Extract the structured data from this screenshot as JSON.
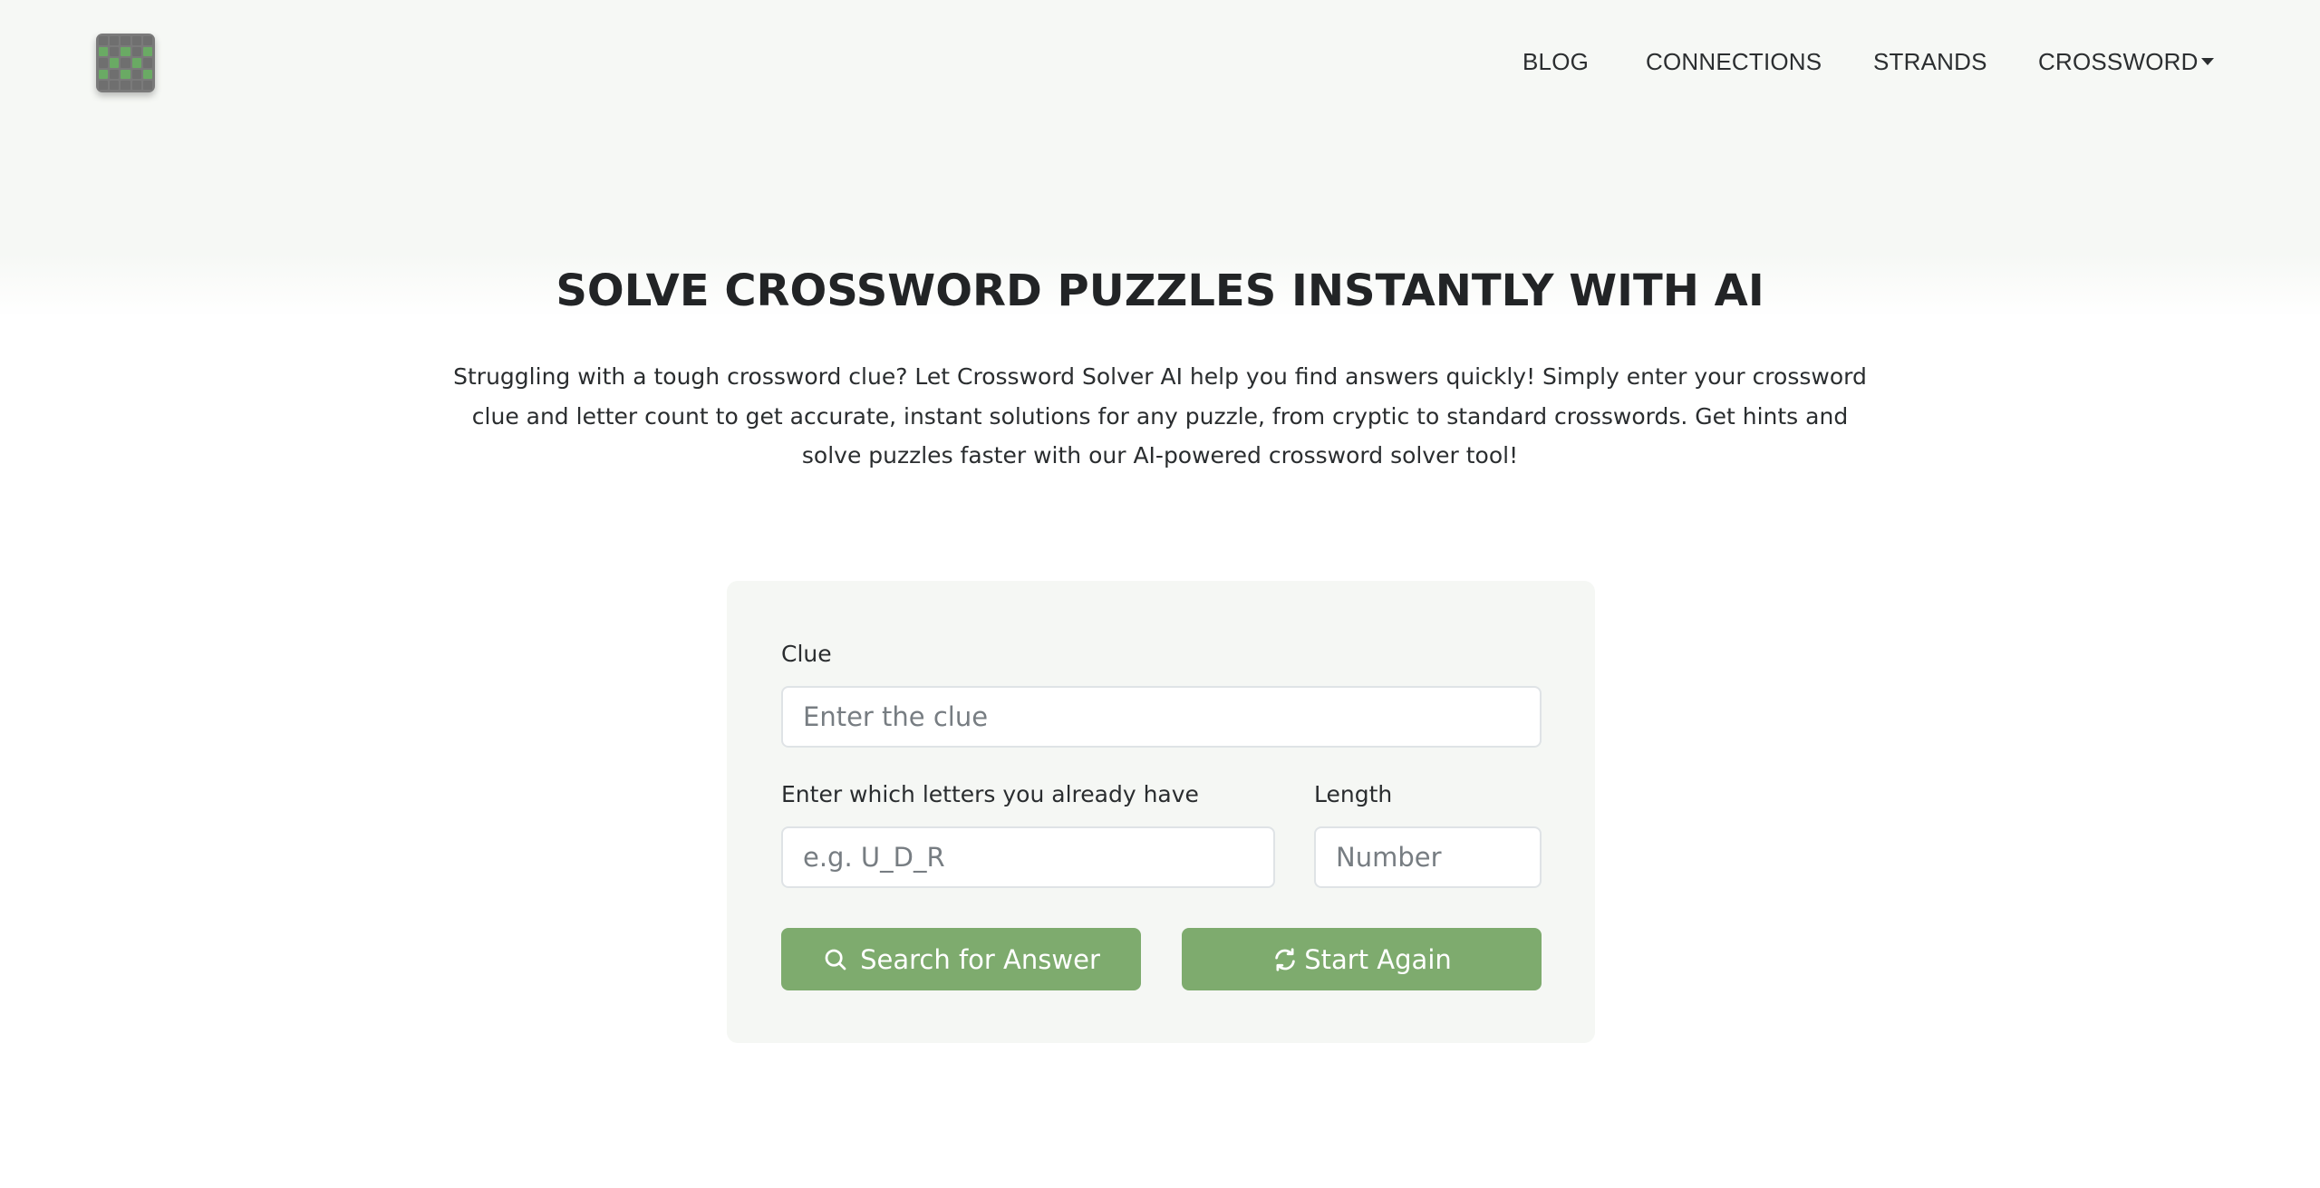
{
  "header": {
    "logo_icon": "crossword-grid-logo-icon",
    "nav": [
      {
        "label": "BLOG"
      },
      {
        "label": "CONNECTIONS"
      },
      {
        "label": "STRANDS"
      },
      {
        "label": "CROSSWORD",
        "has_dropdown": true
      }
    ]
  },
  "hero": {
    "title": "SOLVE CROSSWORD PUZZLES INSTANTLY WITH AI",
    "description": "Struggling with a tough crossword clue? Let Crossword Solver AI help you find answers quickly! Simply enter your crossword clue and letter count to get accurate, instant solutions for any puzzle, from cryptic to standard crosswords. Get hints and solve puzzles faster with our AI-powered crossword solver tool!"
  },
  "form": {
    "clue_label": "Clue",
    "clue_placeholder": "Enter the clue",
    "clue_value": "",
    "letters_label": "Enter which letters you already have",
    "letters_placeholder": "e.g. U_D_R",
    "letters_value": "",
    "length_label": "Length",
    "length_placeholder": "Number",
    "length_value": "",
    "search_button": {
      "label": "Search for Answer",
      "icon": "search-icon"
    },
    "reset_button": {
      "label": "Start Again",
      "icon": "refresh-icon"
    }
  },
  "colors": {
    "accent": "#7eab6e",
    "logo_green": "#6aaa64",
    "logo_gray": "#7a7a7a",
    "header_bg": "#f6f8f5",
    "card_bg": "#f5f7f4",
    "text": "#222426"
  }
}
